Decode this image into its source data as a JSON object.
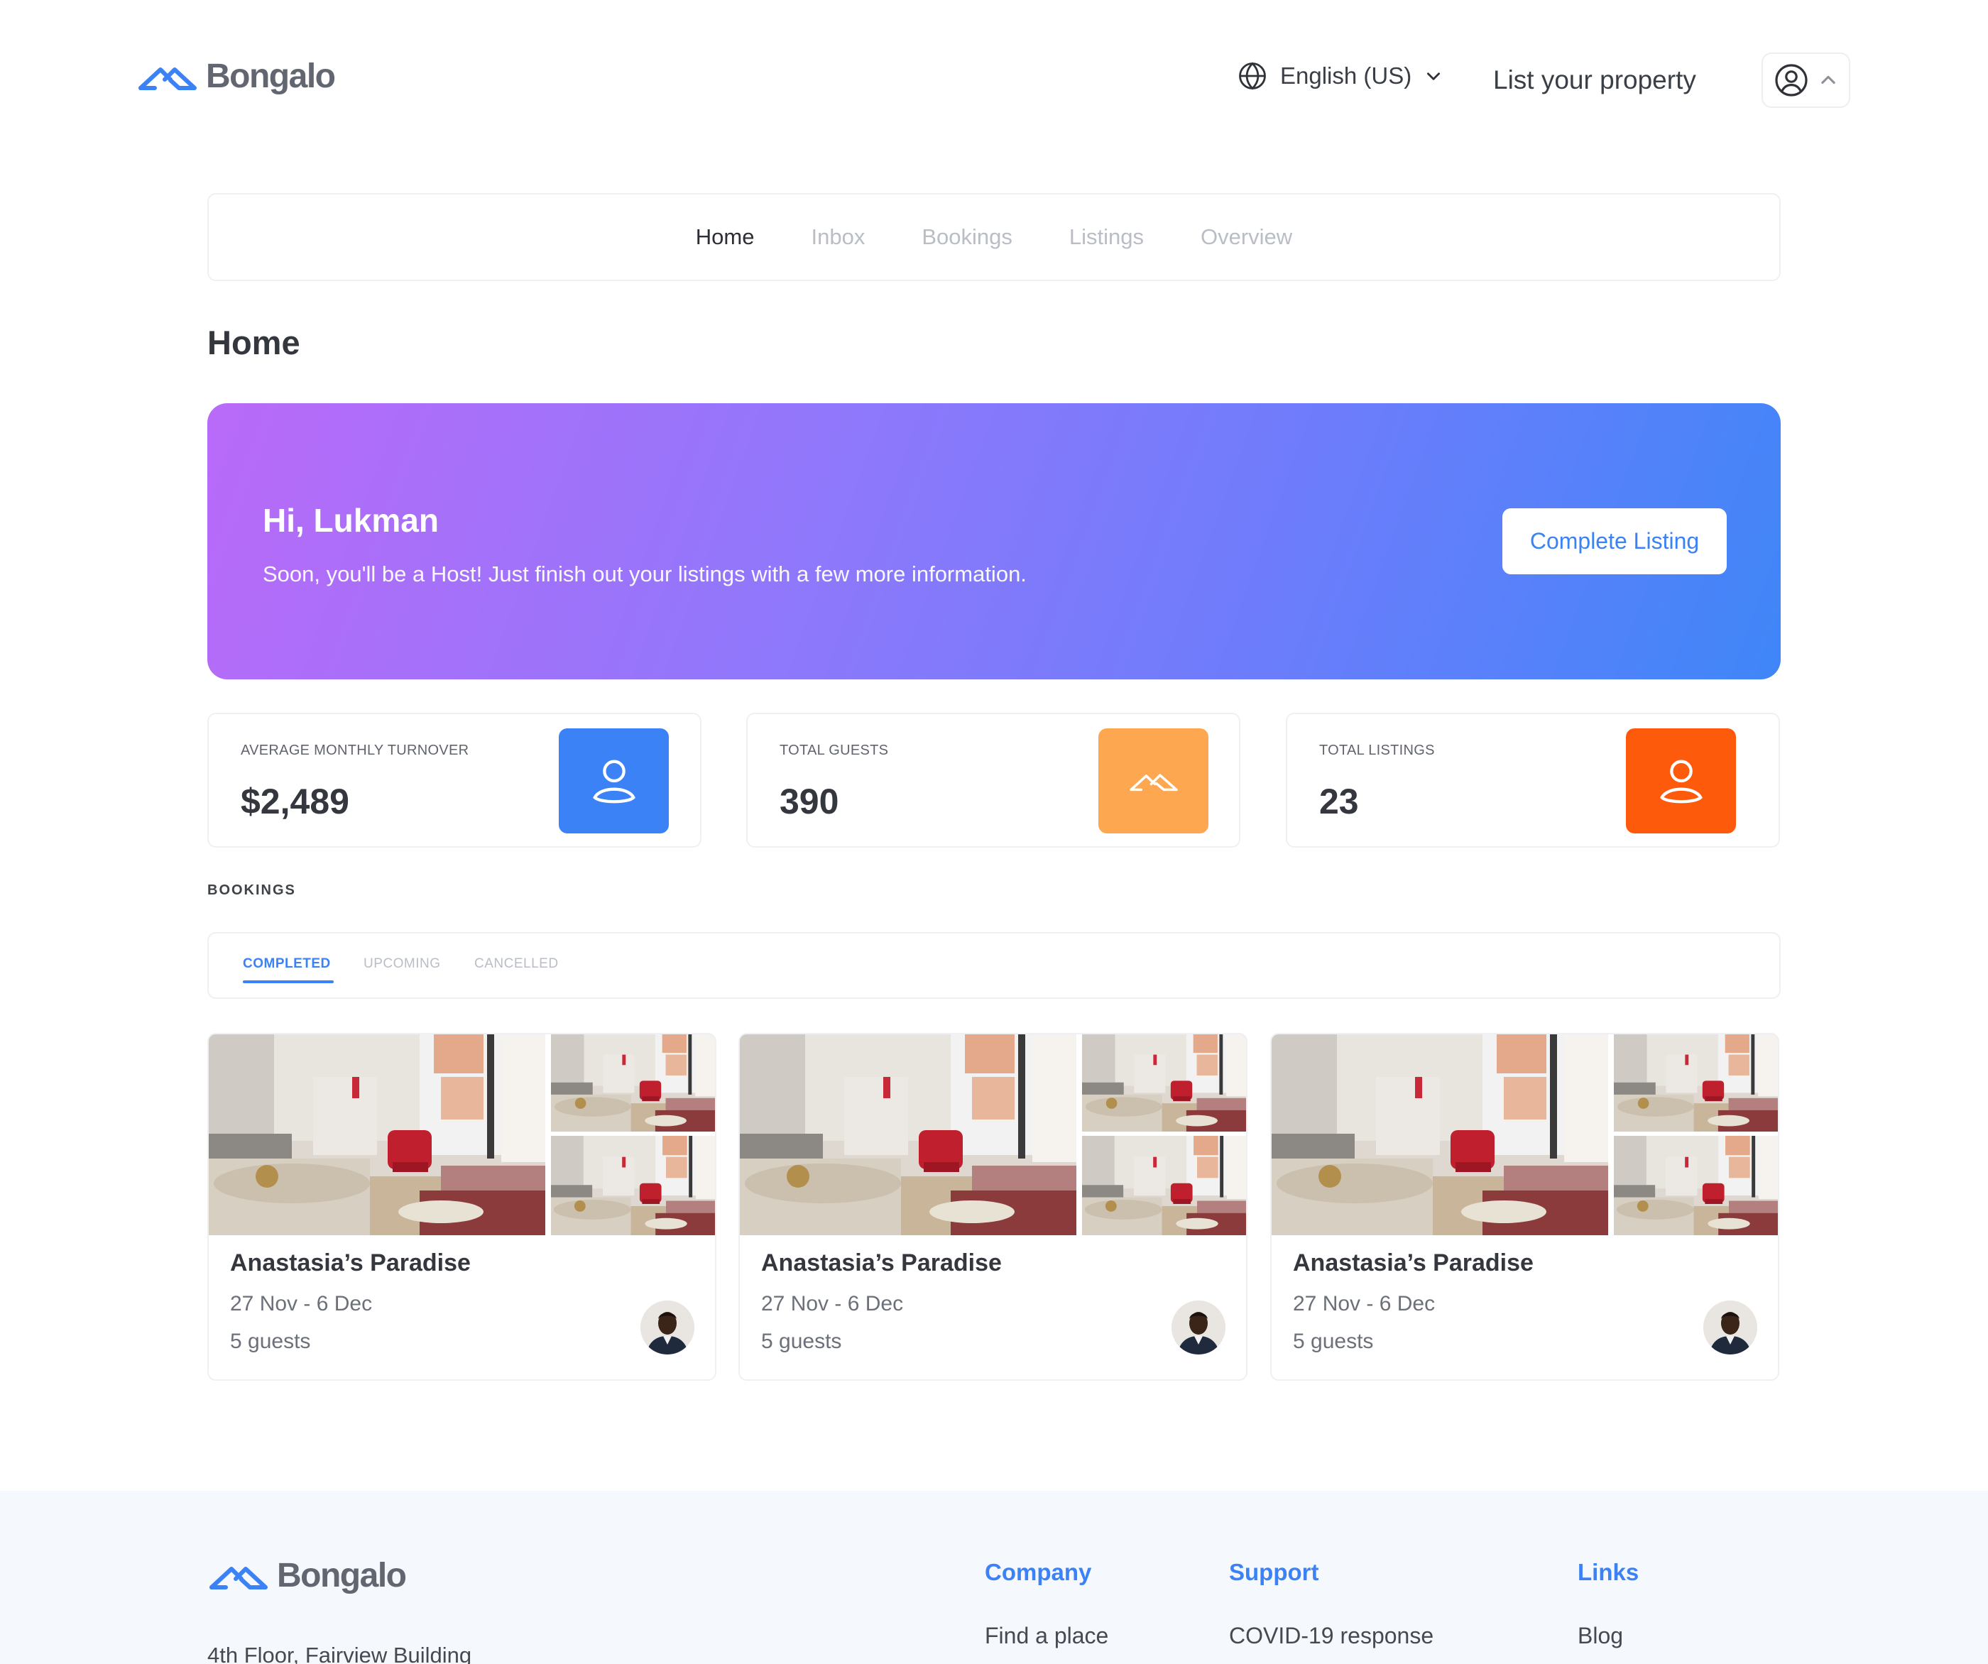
{
  "brand": {
    "name": "Bongalo",
    "accent": "#3b82f6"
  },
  "header": {
    "language": "English (US)",
    "list_property": "List your property"
  },
  "nav": {
    "tabs": [
      {
        "label": "Home",
        "active": true
      },
      {
        "label": "Inbox",
        "active": false
      },
      {
        "label": "Bookings",
        "active": false
      },
      {
        "label": "Listings",
        "active": false
      },
      {
        "label": "Overview",
        "active": false
      }
    ]
  },
  "page": {
    "title": "Home"
  },
  "hero": {
    "greeting": "Hi, Lukman",
    "message": "Soon, you'll be a Host! Just finish out your listings with a few more information.",
    "cta": "Complete Listing"
  },
  "stats": [
    {
      "label": "AVERAGE MONTHLY TURNOVER",
      "value": "$2,489",
      "icon": "user-icon",
      "color": "#3b82f6"
    },
    {
      "label": "TOTAL GUESTS",
      "value": "390",
      "icon": "bongalo-mark-icon",
      "color": "#fda750"
    },
    {
      "label": "TOTAL LISTINGS",
      "value": "23",
      "icon": "user-icon",
      "color": "#fe5a0c"
    }
  ],
  "bookings": {
    "section_label": "BOOKINGS",
    "tabs": [
      {
        "label": "COMPLETED",
        "active": true
      },
      {
        "label": "UPCOMING",
        "active": false
      },
      {
        "label": "CANCELLED",
        "active": false
      }
    ],
    "cards": [
      {
        "name": "Anastasia’s Paradise",
        "dates": "27 Nov - 6 Dec",
        "guests": "5 guests"
      },
      {
        "name": "Anastasia’s Paradise",
        "dates": "27 Nov - 6 Dec",
        "guests": "5 guests"
      },
      {
        "name": "Anastasia’s Paradise",
        "dates": "27 Nov - 6 Dec",
        "guests": "5 guests"
      }
    ]
  },
  "footer": {
    "address_line1": "4th Floor, Fairview Building",
    "columns": [
      {
        "heading": "Company",
        "first_link": "Find a place"
      },
      {
        "heading": "Support",
        "first_link": "COVID-19 response"
      },
      {
        "heading": "Links",
        "first_link": "Blog"
      }
    ]
  }
}
